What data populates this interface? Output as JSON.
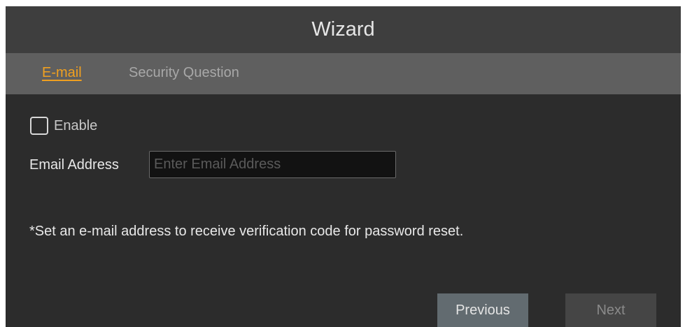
{
  "window": {
    "title": "Wizard"
  },
  "tabs": [
    {
      "label": "E-mail",
      "active": true
    },
    {
      "label": "Security Question",
      "active": false
    }
  ],
  "form": {
    "enable_label": "Enable",
    "enable_checked": false,
    "email_label": "Email Address",
    "email_value": "",
    "email_placeholder": "Enter Email Address",
    "note": "*Set an e-mail address to receive verification code for password reset."
  },
  "buttons": {
    "previous": "Previous",
    "next": "Next"
  },
  "colors": {
    "accent": "#f0a020",
    "background": "#2c2c2c",
    "titlebar": "#3e3e3e",
    "tabbar": "#5f5f5f"
  }
}
